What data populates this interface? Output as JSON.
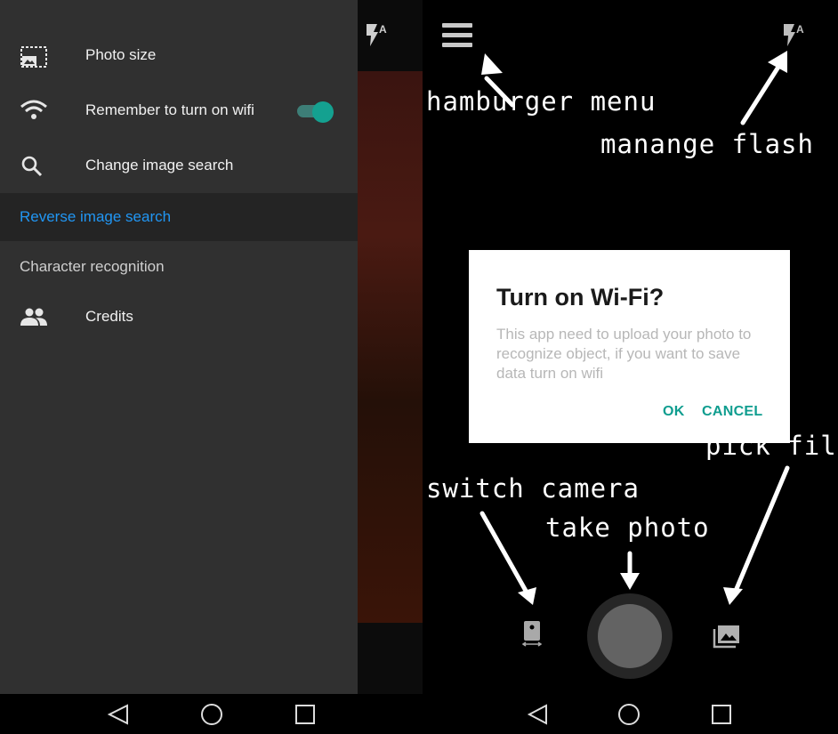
{
  "drawer": {
    "items": [
      {
        "label": "Photo size",
        "icon": "photo-size-icon"
      },
      {
        "label": "Remember to turn on wifi",
        "icon": "wifi-icon",
        "toggle_on": true
      },
      {
        "label": "Change image search",
        "icon": "search-icon"
      }
    ],
    "selected_label": "Reverse image search",
    "plain_label": "Character recognition",
    "credits": {
      "label": "Credits",
      "icon": "people-icon"
    }
  },
  "navbar": {
    "icons": [
      "back-icon",
      "home-icon",
      "recents-icon"
    ]
  },
  "dialog": {
    "title": "Turn on Wi-Fi?",
    "message": "This app need to upload your photo to recognize object, if you want to save data turn on wifi",
    "ok_label": "OK",
    "cancel_label": "CANCEL"
  },
  "annotations": {
    "hamburger": "hamburger menu",
    "flash": "manange flash",
    "pick_file": "pick file",
    "switch_camera": "switch camera",
    "take_photo": "take photo"
  },
  "colors": {
    "accent_blue": "#2196f3",
    "teal": "#0f9d8f",
    "drawer_bg": "#303030"
  }
}
